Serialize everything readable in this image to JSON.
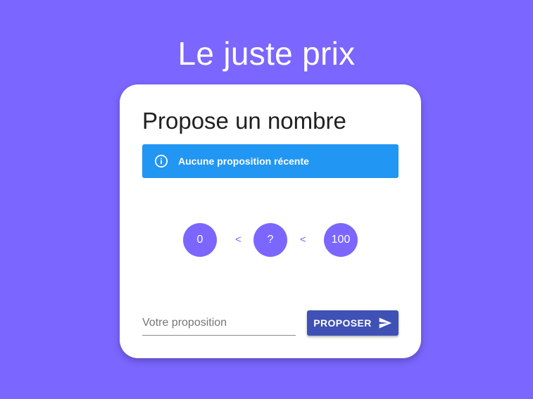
{
  "app": {
    "title": "Le juste prix"
  },
  "card": {
    "title": "Propose un nombre",
    "alert": {
      "text": "Aucune proposition récente",
      "icon": "info-icon",
      "color": "#2196f3"
    },
    "range": {
      "min": "0",
      "unknown": "?",
      "max": "100",
      "separator": "<"
    },
    "input": {
      "placeholder": "Votre proposition",
      "value": ""
    },
    "submit": {
      "label": "PROPOSER",
      "icon": "send-icon",
      "color": "#3f51b5"
    }
  },
  "colors": {
    "background": "#7b66ff",
    "accent": "#7b66ff"
  }
}
